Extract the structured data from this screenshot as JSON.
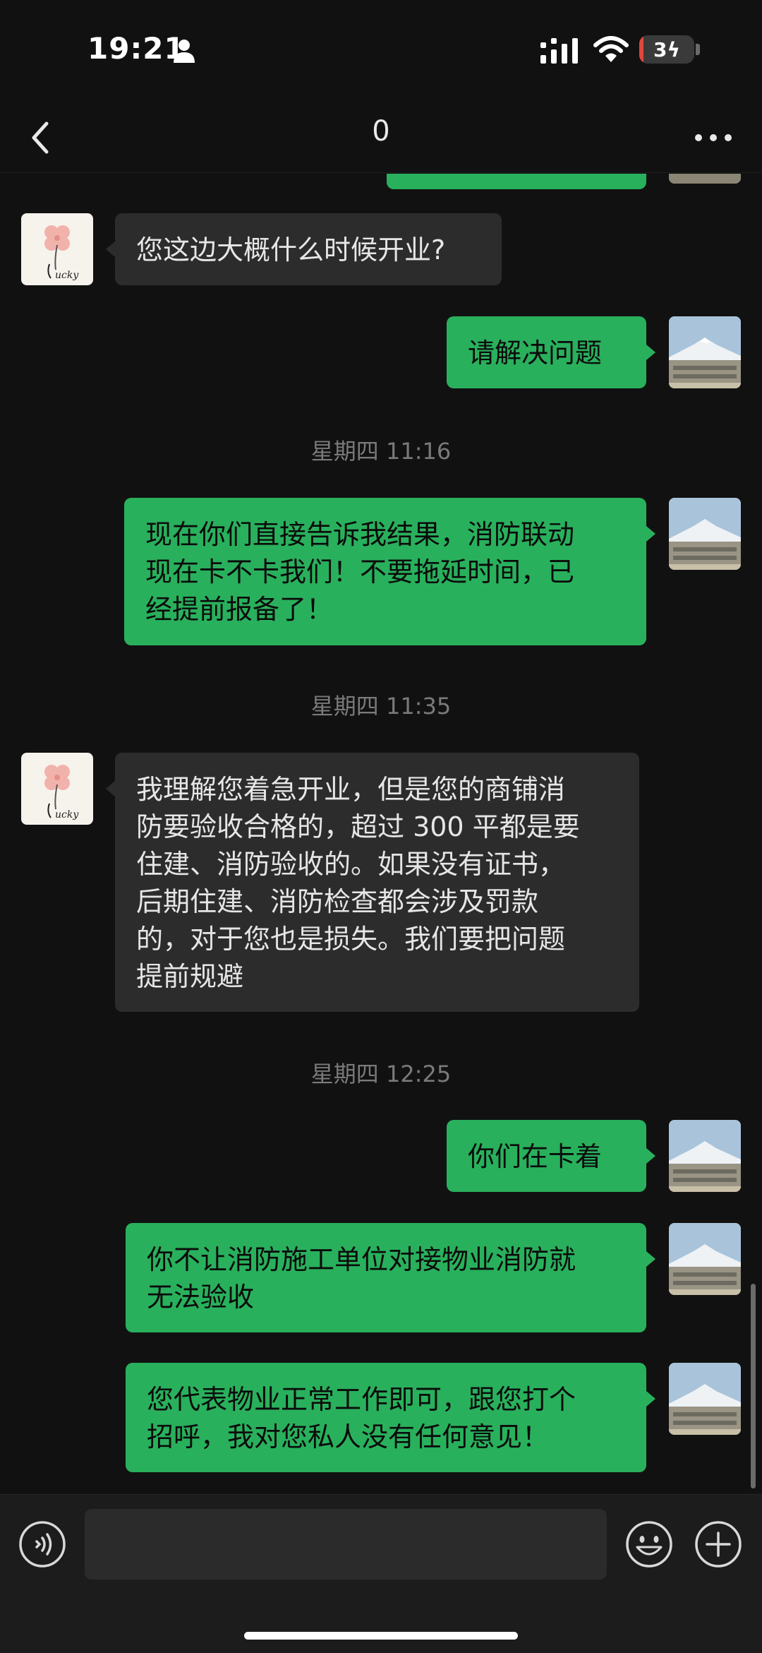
{
  "status_bar": {
    "time": "19:21",
    "battery_level": "3",
    "battery_fraction": 0.03,
    "icons": [
      "person-icon",
      "signal-icon",
      "wifi-icon",
      "battery-icon"
    ]
  },
  "header": {
    "title": "0",
    "back_icon": "chevron-left-icon",
    "more_icon": "more-dots-icon"
  },
  "messages": [
    {
      "type": "text",
      "side": "in",
      "text": "您这边大概什么时候开业?",
      "avatar": "lucky-clover"
    },
    {
      "type": "text",
      "side": "out",
      "text": "请解决问题",
      "avatar": "mountain-photo"
    },
    {
      "type": "time",
      "text": "星期四 11:16"
    },
    {
      "type": "text",
      "side": "out",
      "lines": [
        "现在你们直接告诉我结果，消防联动",
        "现在卡不卡我们！不要拖延时间，已",
        "经提前报备了！"
      ],
      "avatar": "mountain-photo"
    },
    {
      "type": "time",
      "text": "星期四 11:35"
    },
    {
      "type": "text",
      "side": "in",
      "lines": [
        "我理解您着急开业，但是您的商铺消",
        "防要验收合格的，超过 300 平都是要",
        "住建、消防验收的。如果没有证书，",
        "后期住建、消防检查都会涉及罚款",
        "的，对于您也是损失。我们要把问题",
        "提前规避"
      ],
      "avatar": "lucky-clover"
    },
    {
      "type": "time",
      "text": "星期四 12:25"
    },
    {
      "type": "text",
      "side": "out",
      "text": "你们在卡着",
      "avatar": "mountain-photo"
    },
    {
      "type": "text",
      "side": "out",
      "lines": [
        "你不让消防施工单位对接物业消防就",
        "无法验收"
      ],
      "avatar": "mountain-photo"
    },
    {
      "type": "text",
      "side": "out",
      "lines": [
        "您代表物业正常工作即可，跟您打个",
        "招呼，我对您私人没有任何意见！"
      ],
      "avatar": "mountain-photo"
    }
  ],
  "avatar_text": {
    "lucky": "ucky"
  },
  "input_bar": {
    "placeholder": "",
    "voice_icon": "voice-icon",
    "emoji_icon": "emoji-icon",
    "plus_icon": "plus-icon"
  },
  "colors": {
    "background": "#111111",
    "outgoing_bubble": "#29b05c",
    "incoming_bubble": "#2c2c2c",
    "timestamp": "#7a7a7a",
    "battery_low": "#e0473f"
  }
}
